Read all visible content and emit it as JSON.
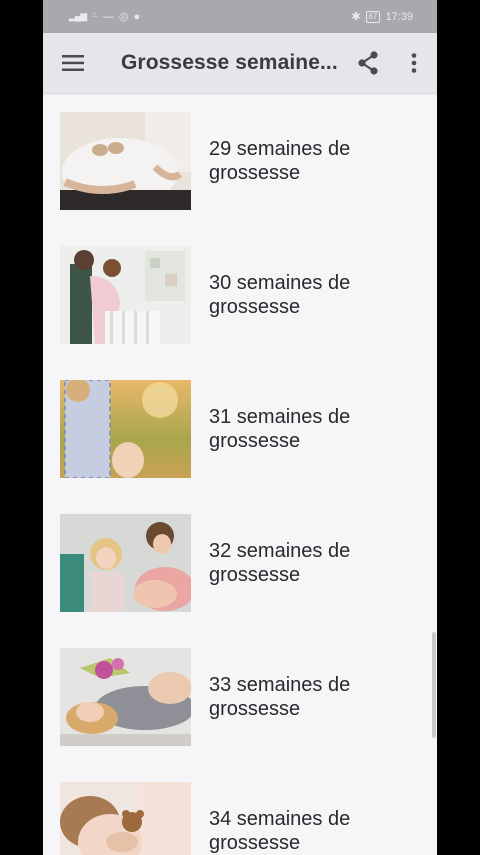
{
  "status_bar": {
    "left_icons": [
      "signal-icon",
      "wifi-icon",
      "notification-icon",
      "instagram-icon",
      "facebook-icon"
    ],
    "bluetooth": "bluetooth-icon",
    "battery": "67",
    "time": "17:39"
  },
  "toolbar": {
    "title": "Grossesse semaine...",
    "menu_icon": "hamburger-menu-icon",
    "share_icon": "share-icon",
    "more_icon": "more-vertical-icon"
  },
  "colors": {
    "status_bar": "#a9a9ad",
    "toolbar": "#e6e6ea",
    "background": "#f6f6f8",
    "text": "#2a2a2e"
  },
  "items": [
    {
      "label": "29 semaines de grossesse"
    },
    {
      "label": "30 semaines de grossesse"
    },
    {
      "label": "31 semaines de grossesse"
    },
    {
      "label": "32 semaines de grossesse"
    },
    {
      "label": "33 semaines de grossesse"
    },
    {
      "label": "34 semaines de grossesse"
    }
  ]
}
